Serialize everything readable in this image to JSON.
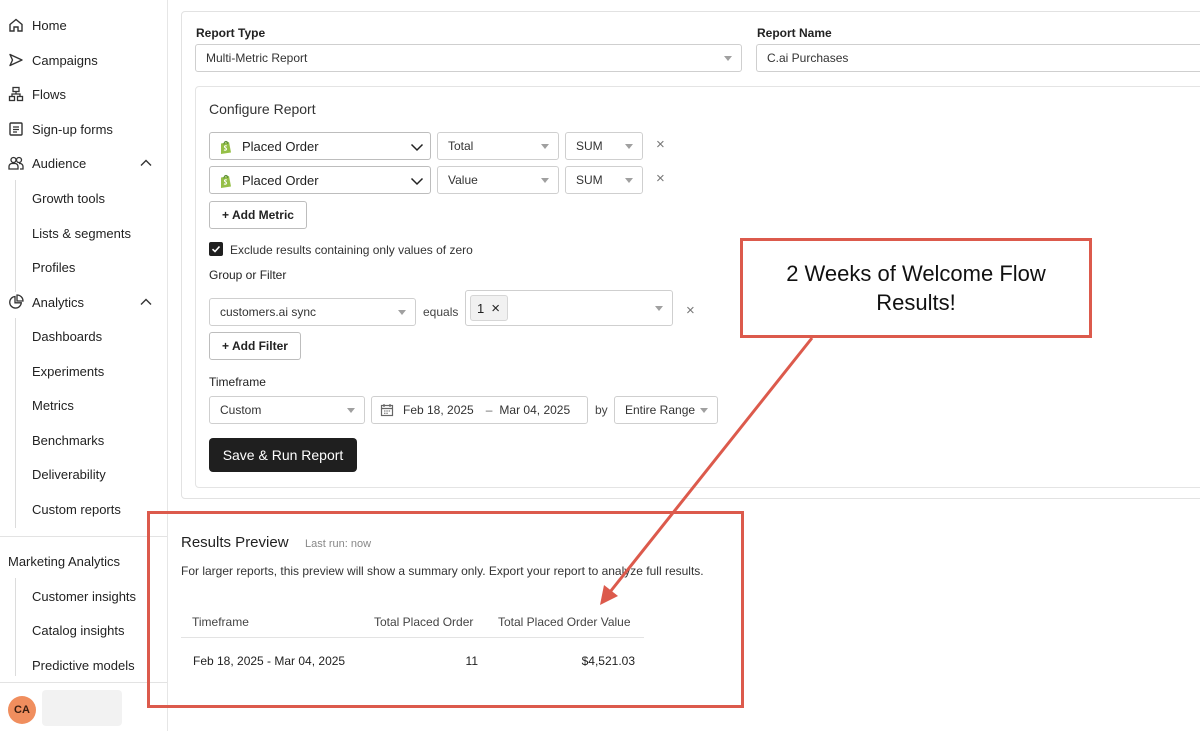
{
  "sidebar": {
    "nav": [
      {
        "label": "Home",
        "icon": "home-icon"
      },
      {
        "label": "Campaigns",
        "icon": "send-icon"
      },
      {
        "label": "Flows",
        "icon": "flows-icon"
      },
      {
        "label": "Sign-up forms",
        "icon": "form-icon"
      },
      {
        "label": "Audience",
        "icon": "audience-icon"
      },
      {
        "label": "Analytics",
        "icon": "pie-chart-icon"
      }
    ],
    "audience_items": [
      "Growth tools",
      "Lists & segments",
      "Profiles"
    ],
    "analytics_items": [
      "Dashboards",
      "Experiments",
      "Metrics",
      "Benchmarks",
      "Deliverability",
      "Custom reports"
    ],
    "marketing_analytics": {
      "label": "Marketing Analytics",
      "items": [
        "Customer insights",
        "Catalog insights",
        "Predictive models"
      ]
    },
    "avatar_initials": "CA"
  },
  "report": {
    "type_label": "Report Type",
    "type_value": "Multi-Metric Report",
    "name_label": "Report Name",
    "name_value": "C.ai Purchases"
  },
  "configure": {
    "title": "Configure Report",
    "metrics": [
      {
        "metric": "Placed Order",
        "measure": "Total",
        "agg": "SUM"
      },
      {
        "metric": "Placed Order",
        "measure": "Value",
        "agg": "SUM"
      }
    ],
    "add_metric": "+ Add Metric",
    "exclude_label": "Exclude results containing only values of zero",
    "exclude_checked": true,
    "group_label": "Group or Filter",
    "filter_field": "customers.ai sync",
    "filter_op": "equals",
    "filter_value": "1",
    "add_filter": "+ Add Filter",
    "timeframe_label": "Timeframe",
    "timeframe_mode": "Custom",
    "date_start": "Feb 18, 2025",
    "date_sep": "–",
    "date_end": "Mar 04, 2025",
    "by_label": "by",
    "group_by": "Entire Range",
    "run_button": "Save & Run Report",
    "close_symbol": "×"
  },
  "results": {
    "title": "Results Preview",
    "last_run": "Last run: now",
    "note": "For larger reports, this preview will show a summary only. Export your report to analyze full results.",
    "headers": [
      "Timeframe",
      "Total Placed Order",
      "Total Placed Order Value"
    ],
    "row": [
      "Feb 18, 2025 - Mar 04, 2025",
      "11",
      "$4,521.03"
    ]
  },
  "annotation": {
    "text": "2 Weeks of Welcome Flow Results!",
    "color": "#dc5a4c"
  }
}
